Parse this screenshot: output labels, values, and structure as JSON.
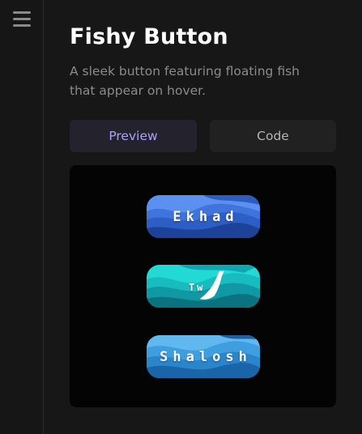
{
  "sidebar": {
    "menu_icon": "hamburger-menu-icon"
  },
  "header": {
    "title": "Fishy Button",
    "subtitle": "A sleek button featuring floating fish that appear on hover."
  },
  "tabs": [
    {
      "label": "Preview",
      "active": true
    },
    {
      "label": "Code",
      "active": false
    }
  ],
  "preview": {
    "buttons": [
      {
        "label": "Ekhad",
        "colors": [
          "#5c8ff0",
          "#2b5fc7",
          "#1c3f94"
        ]
      },
      {
        "label": "Tw",
        "colors": [
          "#29e0dc",
          "#14a8b0",
          "#0c6f7c"
        ],
        "icon": "fish-icon"
      },
      {
        "label": "Shalosh",
        "colors": [
          "#5fb7ee",
          "#2d89cf",
          "#16599e"
        ]
      }
    ]
  },
  "colors": {
    "background": "#171717",
    "panel": "#040404",
    "accent": "#a9a3f2"
  }
}
